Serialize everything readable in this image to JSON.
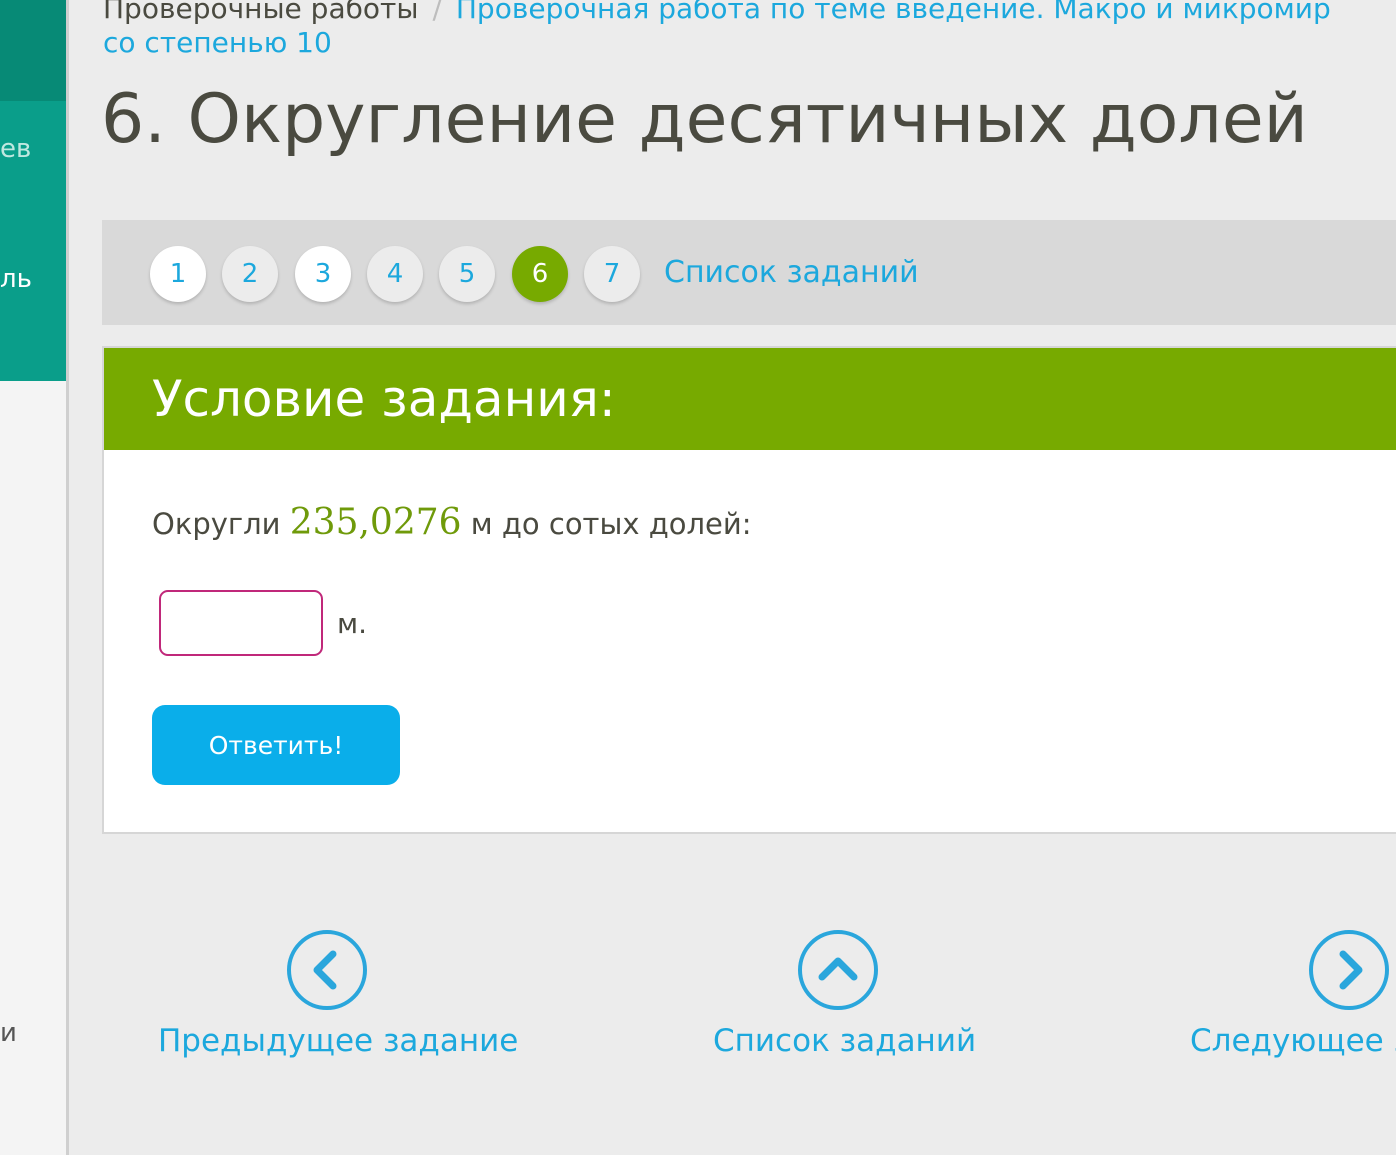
{
  "sidebar": {
    "fragments": [
      "ев",
      "ль",
      "и"
    ]
  },
  "breadcrumb": {
    "first": "Проверочные работы",
    "separator": "/",
    "link_line1": "Проверочная работа по теме введение. Макро и микромир",
    "link_line2": "со степенью 10"
  },
  "page_title": "6. Округление десятичных долей",
  "pager": {
    "pages": [
      {
        "label": "1",
        "state": "done"
      },
      {
        "label": "2",
        "state": "todo"
      },
      {
        "label": "3",
        "state": "done"
      },
      {
        "label": "4",
        "state": "todo"
      },
      {
        "label": "5",
        "state": "todo"
      },
      {
        "label": "6",
        "state": "current"
      },
      {
        "label": "7",
        "state": "todo"
      }
    ],
    "list_link": "Список заданий"
  },
  "task": {
    "header": "Условие задания:",
    "prefix": "Округли",
    "number": "235,0276",
    "suffix": "м до сотых долей:",
    "input_value": "",
    "unit": "м.",
    "submit_label": "Ответить!"
  },
  "bottom_nav": {
    "prev": "Предыдущее задание",
    "list": "Список заданий",
    "next": "Следующее задание"
  },
  "colors": {
    "accent_green": "#77aa00",
    "link_blue": "#1ca8dd",
    "button_blue": "#0aaeea",
    "sidebar_teal": "#0a9e8a",
    "input_border": "#c0287a"
  }
}
